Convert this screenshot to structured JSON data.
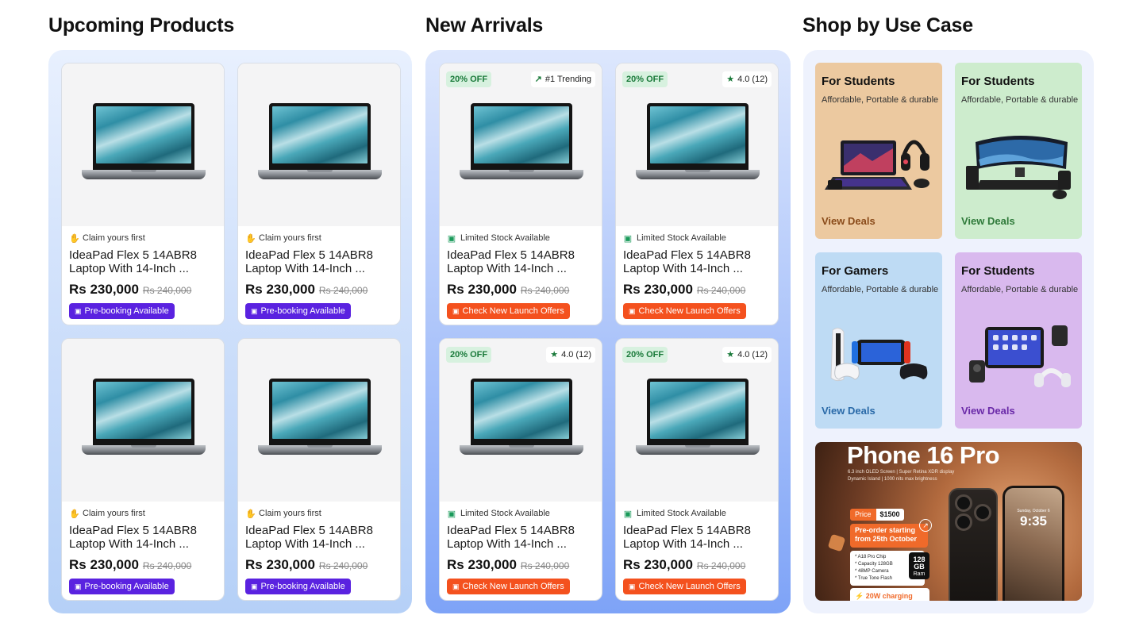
{
  "sections": {
    "upcoming": {
      "title": "Upcoming Products"
    },
    "arrivals": {
      "title": "New Arrivals"
    },
    "usecase": {
      "title": "Shop by Use Case"
    }
  },
  "upcoming_products": [
    {
      "note": "Claim yours first",
      "name1": "IdeaPad Flex 5 14ABR8",
      "name2": "Laptop With 14-Inch ...",
      "price": "Rs 230,000",
      "old_price": "Rs 240,000",
      "cta": "Pre-booking Available"
    },
    {
      "note": "Claim yours first",
      "name1": "IdeaPad Flex 5 14ABR8",
      "name2": "Laptop With 14-Inch ...",
      "price": "Rs 230,000",
      "old_price": "Rs 240,000",
      "cta": "Pre-booking Available"
    },
    {
      "note": "Claim yours first",
      "name1": "IdeaPad Flex 5 14ABR8",
      "name2": "Laptop With 14-Inch ...",
      "price": "Rs 230,000",
      "old_price": "Rs 240,000",
      "cta": "Pre-booking Available"
    },
    {
      "note": "Claim yours first",
      "name1": "IdeaPad Flex 5 14ABR8",
      "name2": "Laptop With 14-Inch ...",
      "price": "Rs 230,000",
      "old_price": "Rs 240,000",
      "cta": "Pre-booking Available"
    }
  ],
  "new_arrivals": [
    {
      "discount": "20% OFF",
      "tag": "#1 Trending",
      "tag_icon": "trending-icon",
      "note": "Limited Stock Available",
      "name1": "IdeaPad Flex 5 14ABR8",
      "name2": "Laptop With 14-Inch ...",
      "price": "Rs 230,000",
      "old_price": "Rs 240,000",
      "cta": "Check New Launch Offers"
    },
    {
      "discount": "20% OFF",
      "tag": "4.0 (12)",
      "tag_icon": "star-icon",
      "note": "Limited Stock Available",
      "name1": "IdeaPad Flex 5 14ABR8",
      "name2": "Laptop With 14-Inch ...",
      "price": "Rs 230,000",
      "old_price": "Rs 240,000",
      "cta": "Check New Launch Offers"
    },
    {
      "discount": "20% OFF",
      "tag": "4.0 (12)",
      "tag_icon": "star-icon",
      "note": "Limited Stock Available",
      "name1": "IdeaPad Flex 5 14ABR8",
      "name2": "Laptop With 14-Inch ...",
      "price": "Rs 230,000",
      "old_price": "Rs 240,000",
      "cta": "Check New Launch Offers"
    },
    {
      "discount": "20% OFF",
      "tag": "4.0 (12)",
      "tag_icon": "star-icon",
      "note": "Limited Stock Available",
      "name1": "IdeaPad Flex 5 14ABR8",
      "name2": "Laptop With 14-Inch ...",
      "price": "Rs 230,000",
      "old_price": "Rs 240,000",
      "cta": "Check New Launch Offers"
    }
  ],
  "use_cases": [
    {
      "title": "For Students",
      "subtitle": "Affordable, Portable & durable",
      "link": "View Deals",
      "bg": "#ecc9a0",
      "link_color": "#8a4b1a"
    },
    {
      "title": "For Students",
      "subtitle": "Affordable, Portable & durable",
      "link": "View Deals",
      "bg": "#cdeccd",
      "link_color": "#2f7a3a"
    },
    {
      "title": "For Gamers",
      "subtitle": "Affordable, Portable & durable",
      "link": "View Deals",
      "bg": "#bedbf4",
      "link_color": "#2a6aa8"
    },
    {
      "title": "For Students",
      "subtitle": "Affordable, Portable & durable",
      "link": "View Deals",
      "bg": "#d9b9ee",
      "link_color": "#6a2aa8"
    }
  ],
  "promo": {
    "title": "Phone 16 Pro",
    "spec_line1": "6.3 inch OLED Screen | Super Retina XDR display",
    "spec_line2": "Dynamic Island | 1000 nits max brightness",
    "price_label": "Price",
    "price_value": "$1500",
    "preorder_line1": "Pre-order starting",
    "preorder_line2": "from 25th October",
    "features": [
      "* A18 Pro Chip",
      "* Capacity 128GB",
      "* 48MP Camera",
      "* True Tone Flash"
    ],
    "storage_num": "128",
    "storage_unit": "GB",
    "storage_sub": "Ram",
    "charge_text": "20W charging",
    "lock_date": "Sunday, October 6",
    "lock_time": "9:35"
  },
  "colors": {
    "purple_cta": "#5a22e0",
    "orange_cta": "#f4511e",
    "discount_green": "#1a7a3a"
  }
}
